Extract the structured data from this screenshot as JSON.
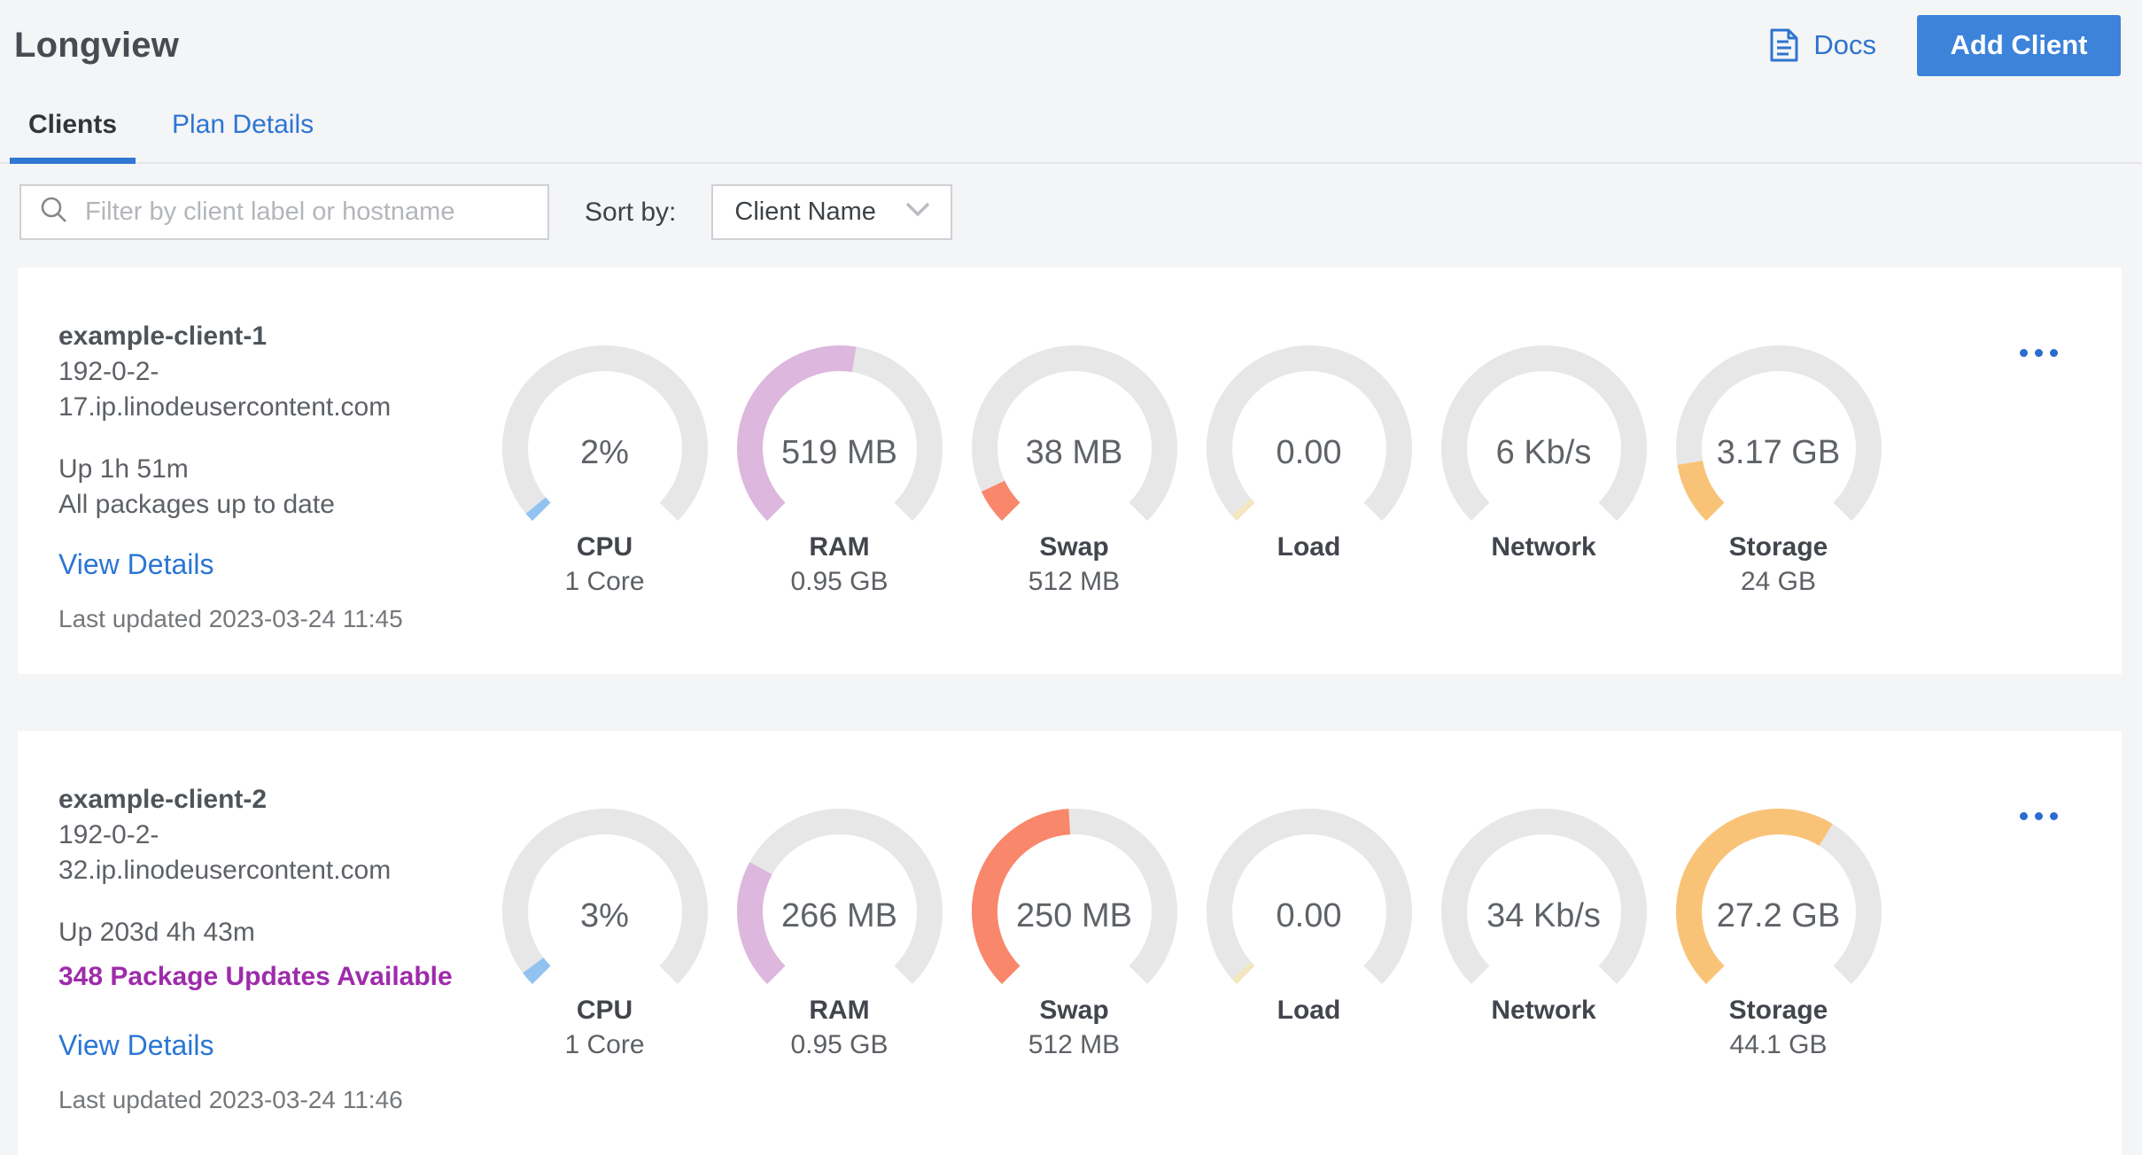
{
  "app": {
    "title": "Longview"
  },
  "header": {
    "docs_label": "Docs",
    "add_client_label": "Add Client"
  },
  "tabs": {
    "clients_label": "Clients",
    "plan_details_label": "Plan Details"
  },
  "filter": {
    "search_placeholder": "Filter by client label or hostname",
    "sort_by_label": "Sort by:",
    "sort_value": "Client Name"
  },
  "theme": {
    "link_blue": "#2e74d0",
    "button_blue": "#3c83d9",
    "tab_underline_blue": "#3178d3",
    "package_updates_purple": "#9e2bab",
    "gauge_track_gray": "#e7e7e7",
    "page_background": "#f4f5f6",
    "card_background": "#ffffff"
  },
  "clients": [
    {
      "name": "example-client-1",
      "hostname": "192-0-2-17.ip.linodeusercontent.com",
      "uptime": "Up 1h 51m",
      "packages": "All packages up to date",
      "packages_highlight": false,
      "view_details_label": "View Details",
      "last_updated": "Last updated 2023-03-24 11:45",
      "gauges": [
        {
          "metric": "CPU",
          "value": "2%",
          "sub": "1 Core",
          "percent": 2,
          "color": "#92c2f0"
        },
        {
          "metric": "RAM",
          "value": "519 MB",
          "sub": "0.95 GB",
          "percent": 53.4,
          "color": "#ddb7de"
        },
        {
          "metric": "Swap",
          "value": "38 MB",
          "sub": "512 MB",
          "percent": 7.4,
          "color": "#f9876c"
        },
        {
          "metric": "Load",
          "value": "0.00",
          "sub": "",
          "percent": 1.5,
          "color": "#f2e7c0"
        },
        {
          "metric": "Network",
          "value": "6 Kb/s",
          "sub": "",
          "percent": 0,
          "color": ""
        },
        {
          "metric": "Storage",
          "value": "3.17 GB",
          "sub": "24 GB",
          "percent": 13.2,
          "color": "#f9c377"
        }
      ]
    },
    {
      "name": "example-client-2",
      "hostname": "192-0-2-32.ip.linodeusercontent.com",
      "uptime": "Up 203d 4h 43m",
      "packages": "348 Package Updates Available",
      "packages_highlight": true,
      "view_details_label": "View Details",
      "last_updated": "Last updated 2023-03-24 11:46",
      "gauges": [
        {
          "metric": "CPU",
          "value": "3%",
          "sub": "1 Core",
          "percent": 3,
          "color": "#92c2f0"
        },
        {
          "metric": "RAM",
          "value": "266 MB",
          "sub": "0.95 GB",
          "percent": 27.3,
          "color": "#ddb7de"
        },
        {
          "metric": "Swap",
          "value": "250 MB",
          "sub": "512 MB",
          "percent": 48.8,
          "color": "#f9876c"
        },
        {
          "metric": "Load",
          "value": "0.00",
          "sub": "",
          "percent": 1.5,
          "color": "#f2e7c0"
        },
        {
          "metric": "Network",
          "value": "34 Kb/s",
          "sub": "",
          "percent": 0,
          "color": ""
        },
        {
          "metric": "Storage",
          "value": "27.2 GB",
          "sub": "44.1 GB",
          "percent": 61.7,
          "color": "#f9c377"
        }
      ]
    }
  ],
  "gauge_geometry": {
    "sweep_degrees": 270,
    "start_degrees": -135
  }
}
